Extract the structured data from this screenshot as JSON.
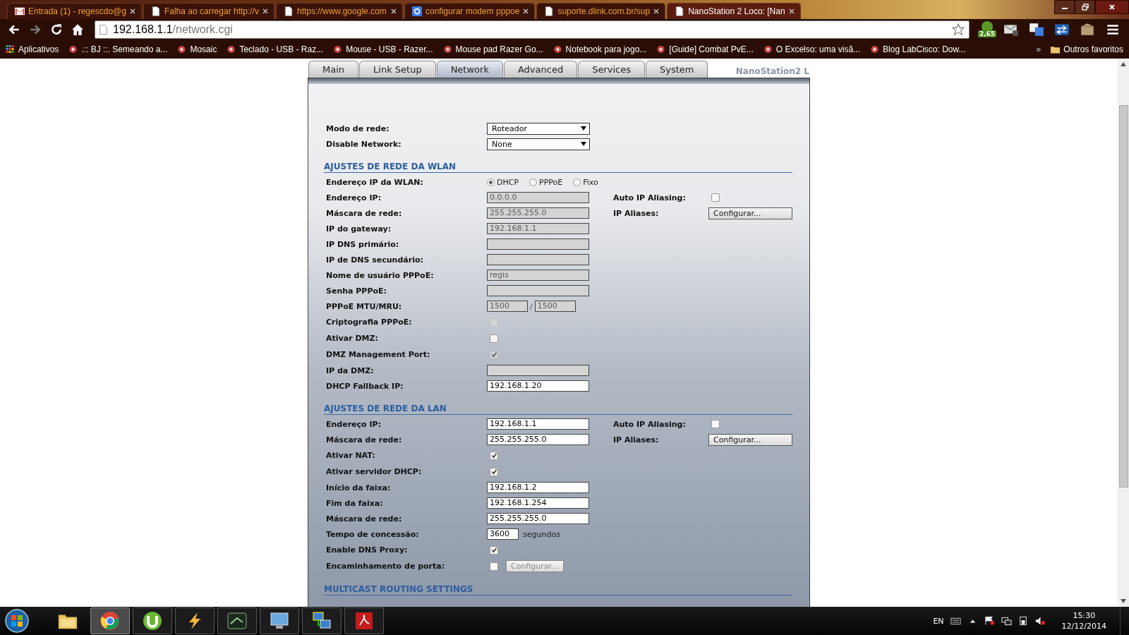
{
  "browser": {
    "tabs": [
      {
        "kind": "mail",
        "title": "Entrada (1) - regescdo@g",
        "selected": false
      },
      {
        "kind": "page",
        "title": "Falha ao carregar http://v",
        "selected": false
      },
      {
        "kind": "page",
        "title": "https://www.google.com",
        "selected": false
      },
      {
        "kind": "search",
        "title": "configurar modem pppoe",
        "selected": false
      },
      {
        "kind": "page",
        "title": "suporte.dlink.com.br/sup",
        "selected": false
      },
      {
        "kind": "page",
        "title": "NanoStation 2 Loco: [Nan",
        "selected": true
      }
    ],
    "address": {
      "host": "192.168.1.1",
      "path": "/network.cgi"
    },
    "extension_badge": "2,65",
    "bookmarks": [
      {
        "kind": "apps",
        "label": "Aplicativos"
      },
      {
        "kind": "site",
        "label": ".:: BJ ::. Semeando a..."
      },
      {
        "kind": "site",
        "label": "Mosaic"
      },
      {
        "kind": "site",
        "label": "Teclado - USB - Raz..."
      },
      {
        "kind": "site",
        "label": "Mouse - USB - Razer..."
      },
      {
        "kind": "site",
        "label": "Mouse pad Razer Go..."
      },
      {
        "kind": "site",
        "label": "Notebook para jogo..."
      },
      {
        "kind": "site",
        "label": "[Guide] Combat PvE..."
      },
      {
        "kind": "site",
        "label": "O Excelso: uma visã..."
      },
      {
        "kind": "site",
        "label": "Blog LabCisco: Dow..."
      }
    ],
    "more": "»",
    "other_bookmarks": "Outros favoritos"
  },
  "page": {
    "nav_tabs": [
      {
        "label": "Main",
        "selected": false
      },
      {
        "label": "Link Setup",
        "selected": false
      },
      {
        "label": "Network",
        "selected": true
      },
      {
        "label": "Advanced",
        "selected": false
      },
      {
        "label": "Services",
        "selected": false
      },
      {
        "label": "System",
        "selected": false
      }
    ],
    "device": "NanoStation2 L",
    "top_fields": [
      {
        "label": "Modo de rede:",
        "value": "Roteador"
      },
      {
        "label": "Disable Network:",
        "value": "None"
      }
    ],
    "sections": [
      {
        "title": "AJUSTES DE REDE DA WLAN",
        "rows": [
          {
            "kind": "radio",
            "label": "Endereço IP da WLAN:",
            "options": [
              {
                "label": "DHCP",
                "selected": true
              },
              {
                "label": "PPPoE",
                "selected": false
              },
              {
                "label": "Fixo",
                "selected": false
              }
            ]
          },
          {
            "kind": "text",
            "label": "Endereço IP:",
            "value": "0.0.0.0",
            "disabled": true,
            "side": {
              "kind": "checkbox",
              "label": "Auto IP Aliasing:",
              "checked": false
            }
          },
          {
            "kind": "text",
            "label": "Máscara de rede:",
            "value": "255.255.255.0",
            "disabled": true,
            "side": {
              "kind": "button",
              "label": "IP Aliases:",
              "button": "Configurar..."
            }
          },
          {
            "kind": "text",
            "label": "IP do gateway:",
            "value": "192.168.1.1",
            "disabled": true
          },
          {
            "kind": "text",
            "label": "IP DNS primário:",
            "disabled": true
          },
          {
            "kind": "text",
            "label": "IP de DNS secundário:",
            "disabled": true
          },
          {
            "kind": "text",
            "label": "Nome de usuário PPPoE:",
            "value": "regis",
            "disabled": true
          },
          {
            "kind": "text",
            "label": "Senha PPPoE:",
            "disabled": true
          },
          {
            "kind": "pair",
            "label": "PPPoE MTU/MRU:",
            "values": [
              "1500",
              "1500"
            ],
            "separator": "/",
            "disabled": true
          },
          {
            "kind": "checkbox",
            "label": "Criptografia PPPoE:",
            "checked": false,
            "disabled": true
          },
          {
            "kind": "checkbox",
            "label": "Ativar DMZ:",
            "checked": false,
            "disabled": false
          },
          {
            "kind": "checkbox",
            "label": "DMZ Management Port:",
            "checked": true,
            "disabled": true
          },
          {
            "kind": "text",
            "label": "IP da DMZ:",
            "disabled": true
          },
          {
            "kind": "text",
            "label": "DHCP Fallback IP:",
            "value": "192.168.1.20",
            "disabled": false
          }
        ]
      },
      {
        "title": "AJUSTES DE REDE DA LAN",
        "rows": [
          {
            "kind": "text",
            "label": "Endereço IP:",
            "value": "192.168.1.1",
            "disabled": false,
            "side": {
              "kind": "checkbox",
              "label": "Auto IP Aliasing:",
              "checked": false
            }
          },
          {
            "kind": "text",
            "label": "Máscara de rede:",
            "value": "255.255.255.0",
            "disabled": false,
            "side": {
              "kind": "button",
              "label": "IP Aliases:",
              "button": "Configurar..."
            }
          },
          {
            "kind": "checkbox",
            "label": "Ativar NAT:",
            "checked": true,
            "disabled": false
          },
          {
            "kind": "checkbox",
            "label": "Ativar servidor DHCP:",
            "checked": true,
            "disabled": false
          },
          {
            "kind": "text",
            "label": "Início da faixa:",
            "value": "192.168.1.2",
            "disabled": false
          },
          {
            "kind": "text",
            "label": "Fim da faixa:",
            "value": "192.168.1.254",
            "disabled": false
          },
          {
            "kind": "text",
            "label": "Máscara de rede:",
            "value": "255.255.255.0",
            "disabled": false
          },
          {
            "kind": "short",
            "label": "Tempo de concessão:",
            "value": "3600",
            "unit": "segundos",
            "disabled": false
          },
          {
            "kind": "checkbox",
            "label": "Enable DNS Proxy:",
            "checked": true,
            "disabled": false
          },
          {
            "kind": "checkbox_button",
            "label": "Encaminhamento de porta:",
            "checked": false,
            "disabled": false,
            "button": "Configurar...",
            "button_disabled": true
          }
        ]
      },
      {
        "title": "MULTICAST ROUTING SETTINGS"
      }
    ]
  },
  "taskbar": {
    "apps": [
      {
        "kind": "folder",
        "open": false,
        "active": false
      },
      {
        "kind": "browser",
        "open": true,
        "active": true
      },
      {
        "kind": "torrent",
        "open": true,
        "active": false
      },
      {
        "kind": "bolt",
        "open": true,
        "active": false
      },
      {
        "kind": "terminal",
        "open": true,
        "active": false
      },
      {
        "kind": "monitor",
        "open": true,
        "active": false
      },
      {
        "kind": "network",
        "open": true,
        "active": false
      },
      {
        "kind": "pdf",
        "open": true,
        "active": false
      }
    ],
    "language": "EN",
    "time": "15:30",
    "date": "12/12/2014"
  }
}
